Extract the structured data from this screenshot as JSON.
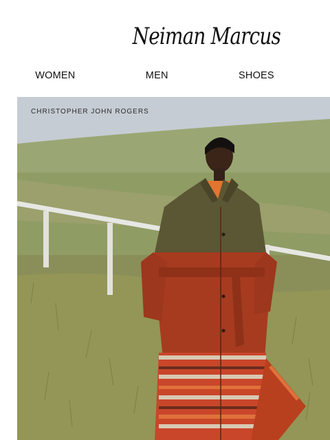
{
  "header": {
    "logo_text": "Neiman Marcus"
  },
  "nav": {
    "items": [
      {
        "label": "WOMEN"
      },
      {
        "label": "MEN"
      },
      {
        "label": "SHOES"
      }
    ]
  },
  "hero": {
    "designer": "CHRISTOPHER JOHN ROGERS",
    "image_icon": "model-in-field-photo"
  },
  "colors": {
    "sky": "#c6ccd3",
    "field": "#8d9a62",
    "coat_olive": "#5a5433",
    "coat_red": "#a33a1f"
  }
}
